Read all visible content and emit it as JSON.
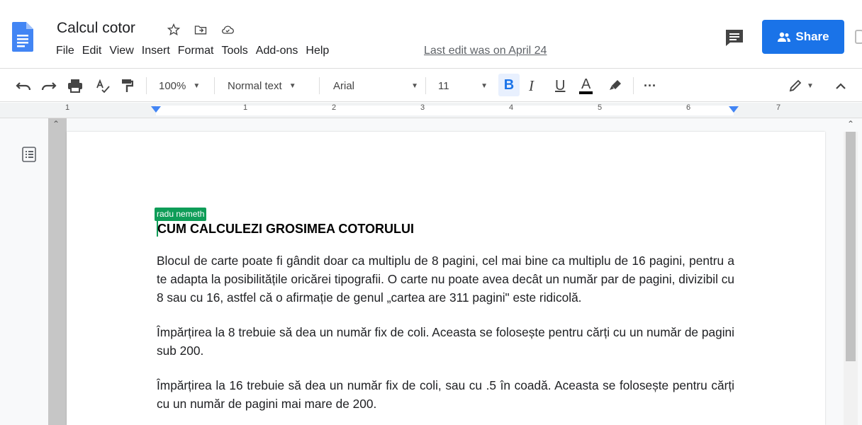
{
  "document": {
    "title": "Calcul cotor",
    "last_edit": "Last edit was on April 24"
  },
  "menu": {
    "items": [
      "File",
      "Edit",
      "View",
      "Insert",
      "Format",
      "Tools",
      "Add-ons",
      "Help"
    ]
  },
  "header": {
    "share_label": "Share"
  },
  "toolbar": {
    "zoom": "100%",
    "style": "Normal text",
    "font": "Arial",
    "font_size": "11",
    "bold": "B",
    "italic": "I",
    "underline": "U",
    "text_color": "A",
    "more": "···"
  },
  "ruler": {
    "numbers": [
      "1",
      "1",
      "2",
      "3",
      "4",
      "5",
      "6",
      "7"
    ]
  },
  "collaborator": {
    "name": "radu nemeth",
    "color": "#0f9d58"
  },
  "content": {
    "heading": "CUM CALCULEZI GROSIMEA COTORULUI",
    "paragraphs": [
      "Blocul de carte poate fi gândit doar ca multiplu de 8 pagini, cel mai bine ca multiplu de 16 pagini, pentru a te adapta la posibilitățile oricărei tipografii. O carte nu poate avea decât un număr par de pagini, divizibil cu 8 sau cu 16, astfel că o afirmație de genul „cartea are 311 pagini\" este ridicolă.",
      "Împărțirea la 8 trebuie să dea un număr fix de coli. Aceasta se folosește pentru cărți cu un număr de pagini sub 200.",
      "Împărțirea la 16 trebuie să dea un număr fix de coli, sau cu .5 în coadă. Aceasta se folosește pentru cărți cu un număr de pagini mai mare de 200."
    ]
  },
  "colors": {
    "accent": "#1a73e8",
    "docs_blue": "#4285f4"
  }
}
